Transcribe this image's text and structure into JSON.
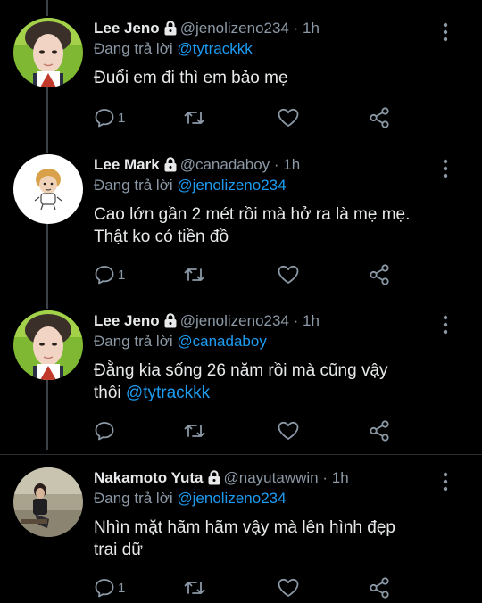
{
  "replying_prefix": "Đang trả lời",
  "tweets": [
    {
      "name": "Lee Jeno",
      "handle": "@jenolizeno234",
      "dot": "·",
      "time": "1h",
      "reply_to": "@tytrackkk",
      "text_lines": [
        "Đuổi em đi thì em bảo mẹ"
      ],
      "trailing_mention": "",
      "reply_count": "1"
    },
    {
      "name": "Lee Mark",
      "handle": "@canadaboy",
      "dot": "·",
      "time": "1h",
      "reply_to": "@jenolizeno234",
      "text_lines": [
        "Cao lớn gần 2 mét rồi mà hở ra là mẹ mẹ.",
        "Thật ko có tiền đồ"
      ],
      "trailing_mention": "",
      "reply_count": "1"
    },
    {
      "name": "Lee Jeno",
      "handle": "@jenolizeno234",
      "dot": "·",
      "time": "1h",
      "reply_to": "@canadaboy",
      "text_lines": [
        "Đằng kia sống 26 năm rồi mà cũng vậy",
        "thôi"
      ],
      "trailing_mention": "@tytrackkk",
      "reply_count": ""
    },
    {
      "name": "Nakamoto Yuta",
      "handle": "@nayutawwin",
      "dot": "·",
      "time": "1h",
      "reply_to": "@jenolizeno234",
      "text_lines": [
        "Nhìn mặt hãm hãm vậy mà lên hình đẹp",
        "trai dữ"
      ],
      "trailing_mention": "",
      "reply_count": "1"
    }
  ],
  "colors": {
    "background": "#000000",
    "text": "#e7e9ea",
    "secondary": "#8b98a5",
    "link": "#1d9bf0",
    "thread_line": "#3d4248"
  },
  "icons": {
    "lock": "lock-icon",
    "more": "more-vertical-icon",
    "reply": "reply-icon",
    "retweet": "retweet-icon",
    "like": "heart-icon",
    "share": "share-icon"
  }
}
